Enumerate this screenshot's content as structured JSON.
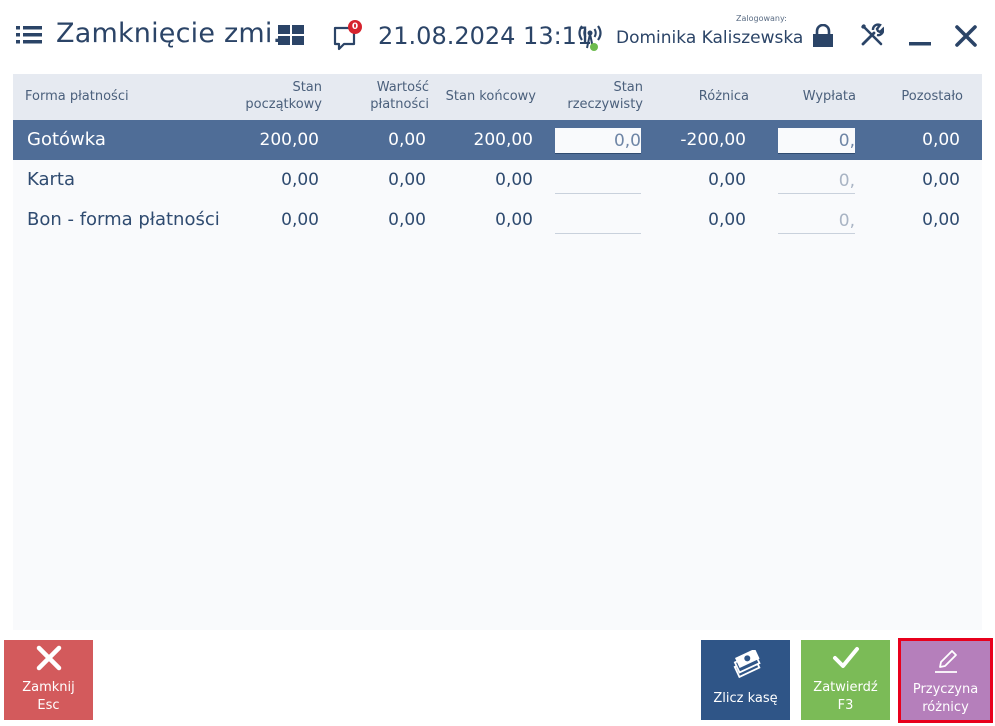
{
  "header": {
    "title": "Zamknięcie zmi...",
    "notification_count": "0",
    "datetime": "21.08.2024 13:11",
    "logged_label": "Zalogowany:",
    "username": "Dominika Kaliszewska"
  },
  "table": {
    "columns": {
      "payment_form": "Forma płatności",
      "opening_line1": "Stan",
      "opening_line2": "początkowy",
      "value_line1": "Wartość",
      "value_line2": "płatności",
      "closing": "Stan końcowy",
      "actual_line1": "Stan",
      "actual_line2": "rzeczywisty",
      "difference": "Różnica",
      "payout": "Wypłata",
      "remaining": "Pozostało"
    },
    "rows": [
      {
        "name": "Gotówka",
        "opening": "200,00",
        "value": "0,00",
        "closing": "200,00",
        "actual": "0,0",
        "difference": "-200,00",
        "payout": "0,",
        "remaining": "0,00"
      },
      {
        "name": "Karta",
        "opening": "0,00",
        "value": "0,00",
        "closing": "0,00",
        "actual": "",
        "difference": "0,00",
        "payout": "0,",
        "remaining": "0,00"
      },
      {
        "name": "Bon - forma płatności",
        "opening": "0,00",
        "value": "0,00",
        "closing": "0,00",
        "actual": "",
        "difference": "0,00",
        "payout": "0,",
        "remaining": "0,00"
      }
    ]
  },
  "buttons": {
    "close_line1": "Zamknij",
    "close_line2": "Esc",
    "count": "Zlicz kasę",
    "confirm_line1": "Zatwierdź",
    "confirm_line2": "F3",
    "reason_line1": "Przyczyna",
    "reason_line2": "różnicy"
  },
  "colors": {
    "selected_row": "#4f6d97",
    "close_button": "#d35a5c",
    "count_button": "#2f5587",
    "confirm_button": "#7bbb57",
    "reason_button": "#b57fbb",
    "highlight_border": "#e8001c"
  }
}
